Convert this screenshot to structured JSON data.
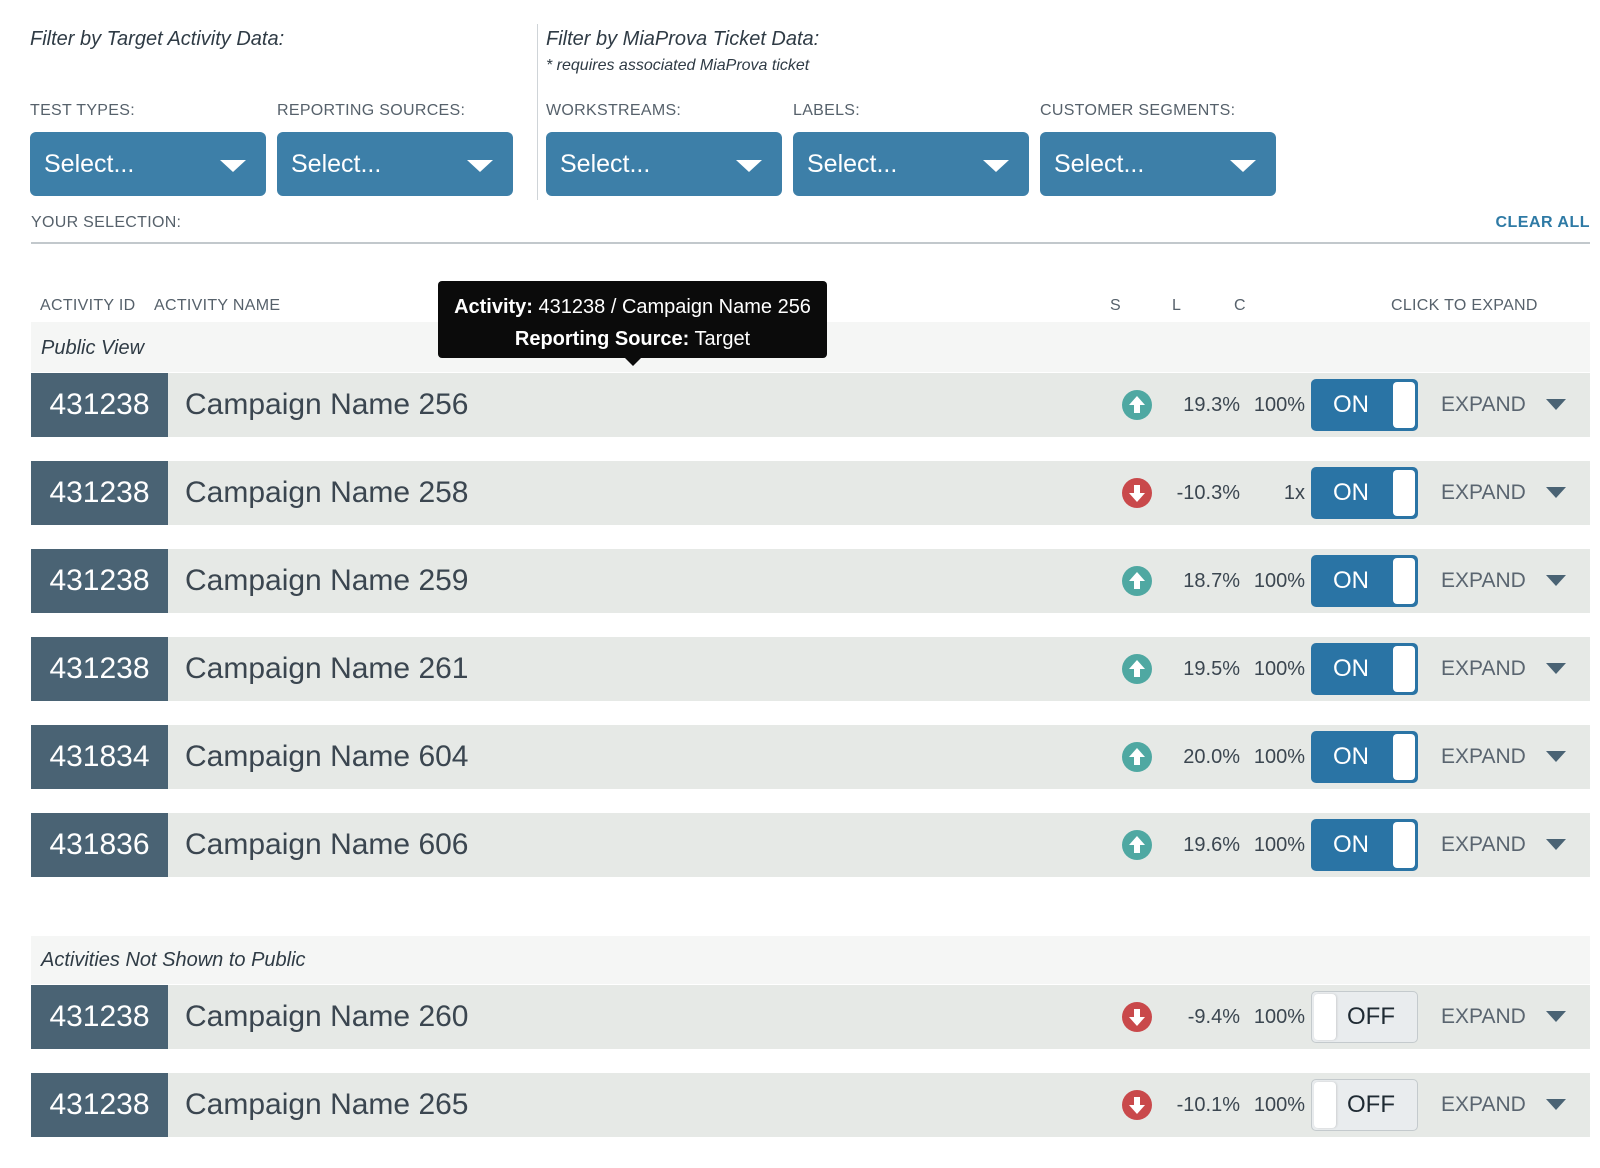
{
  "filters": {
    "target_heading": "Filter by Target Activity Data:",
    "miaprova_heading": "Filter by MiaProva Ticket Data:",
    "miaprova_note": "* requires associated MiaProva ticket",
    "test_types": {
      "label": "TEST TYPES:",
      "value": "Select..."
    },
    "reporting_sources": {
      "label": "REPORTING SOURCES:",
      "value": "Select..."
    },
    "workstreams": {
      "label": "WORKSTREAMS:",
      "value": "Select..."
    },
    "labels": {
      "label": "LABELS:",
      "value": "Select..."
    },
    "customer_segments": {
      "label": "CUSTOMER SEGMENTS:",
      "value": "Select..."
    },
    "your_selection": "YOUR SELECTION:",
    "clear_all": "CLEAR ALL"
  },
  "columns": {
    "activity_id": "ACTIVITY ID",
    "activity_name": "ACTIVITY NAME",
    "s": "S",
    "l": "L",
    "c": "C",
    "click_to_expand": "CLICK TO EXPAND"
  },
  "tooltip": {
    "activity_label": "Activity:",
    "activity_value": "431238 / Campaign Name 256",
    "source_label": "Reporting Source:",
    "source_value": "Target"
  },
  "sections": {
    "public": {
      "title": "Public View",
      "rows": [
        {
          "id": "431238",
          "name": "Campaign Name 256",
          "trend": "up",
          "s": "19.3%",
          "l": "100%",
          "toggle": "ON",
          "expand": "EXPAND"
        },
        {
          "id": "431238",
          "name": "Campaign Name 258",
          "trend": "down",
          "s": "-10.3%",
          "l": "1x",
          "toggle": "ON",
          "expand": "EXPAND"
        },
        {
          "id": "431238",
          "name": "Campaign Name 259",
          "trend": "up",
          "s": "18.7%",
          "l": "100%",
          "toggle": "ON",
          "expand": "EXPAND"
        },
        {
          "id": "431238",
          "name": "Campaign Name 261",
          "trend": "up",
          "s": "19.5%",
          "l": "100%",
          "toggle": "ON",
          "expand": "EXPAND"
        },
        {
          "id": "431834",
          "name": "Campaign Name 604",
          "trend": "up",
          "s": "20.0%",
          "l": "100%",
          "toggle": "ON",
          "expand": "EXPAND"
        },
        {
          "id": "431836",
          "name": "Campaign Name 606",
          "trend": "up",
          "s": "19.6%",
          "l": "100%",
          "toggle": "ON",
          "expand": "EXPAND"
        }
      ]
    },
    "hidden": {
      "title": "Activities Not Shown to Public",
      "rows": [
        {
          "id": "431238",
          "name": "Campaign Name 260",
          "trend": "down",
          "s": "-9.4%",
          "l": "100%",
          "toggle": "OFF",
          "expand": "EXPAND"
        },
        {
          "id": "431238",
          "name": "Campaign Name 265",
          "trend": "down",
          "s": "-10.1%",
          "l": "100%",
          "toggle": "OFF",
          "expand": "EXPAND"
        }
      ]
    }
  },
  "icons": {
    "trend_up": "arrow-up-circle-icon",
    "trend_down": "arrow-down-circle-icon",
    "dropdown": "caret-down-icon"
  },
  "colors": {
    "select_bg": "#3d7fa8",
    "id_cell_bg": "#4a6374",
    "row_bg": "#e6e9e6",
    "toggle_on": "#2a74a5",
    "trend_up": "#4fa8a2",
    "trend_down": "#c9494b",
    "link": "#2e7aa5"
  }
}
